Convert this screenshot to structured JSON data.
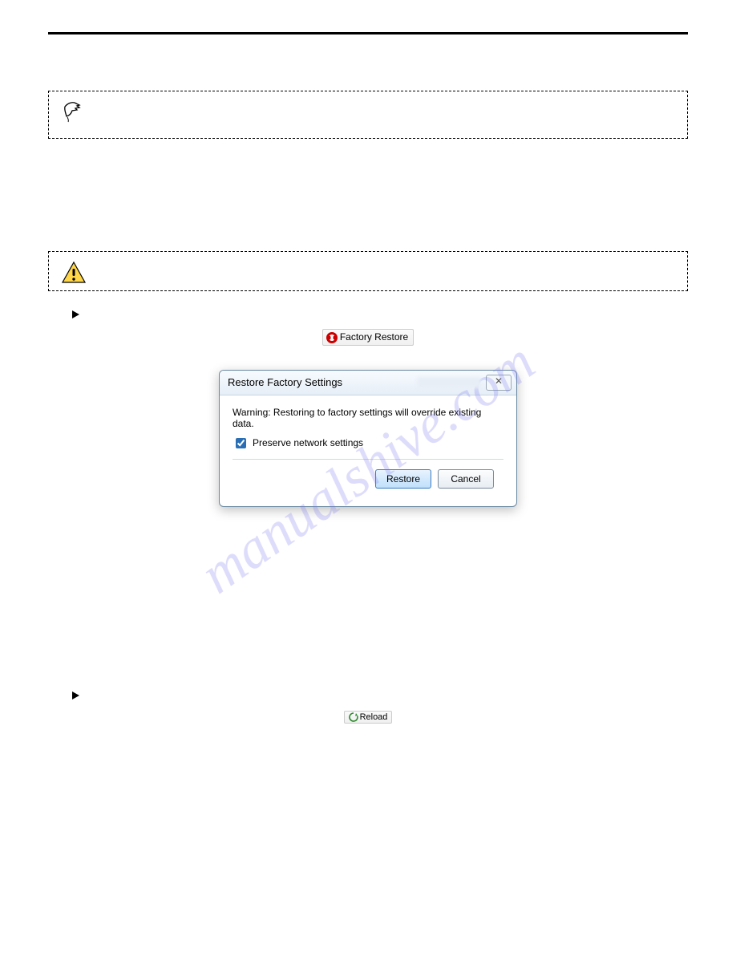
{
  "watermark": "manualshive.com",
  "section1": {
    "toolbar_button_label": "Factory Restore"
  },
  "section2": {
    "reload_button_label": "Reload"
  },
  "dialog": {
    "title": "Restore Factory Settings",
    "warning_text": "Warning: Restoring to factory settings will override existing data.",
    "checkbox_label": "Preserve network settings",
    "checkbox_checked": true,
    "restore_button": "Restore",
    "cancel_button": "Cancel"
  }
}
